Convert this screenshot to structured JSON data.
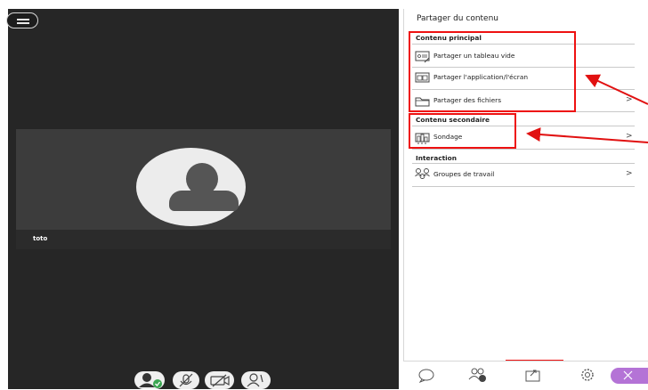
{
  "participant": {
    "name": "toto"
  },
  "panel": {
    "title": "Partager du contenu",
    "sections": {
      "principal": "Contenu principal",
      "secondaire": "Contenu secondaire",
      "interaction": "Interaction"
    },
    "items": {
      "whiteboard": "Partager un tableau vide",
      "app_screen": "Partager l'application/l'écran",
      "files": "Partager des fichiers",
      "poll": "Sondage",
      "groups": "Groupes de travail"
    },
    "chevron": ">"
  },
  "colors": {
    "annotation_red": "#e11111",
    "accent_purple": "#b473d6"
  },
  "icons": [
    "menu-icon",
    "avatar-icon",
    "microphone-muted-icon",
    "camera-muted-icon",
    "hand-raise-icon",
    "chat-icon",
    "participants-icon",
    "share-content-icon",
    "settings-icon",
    "close-icon"
  ]
}
